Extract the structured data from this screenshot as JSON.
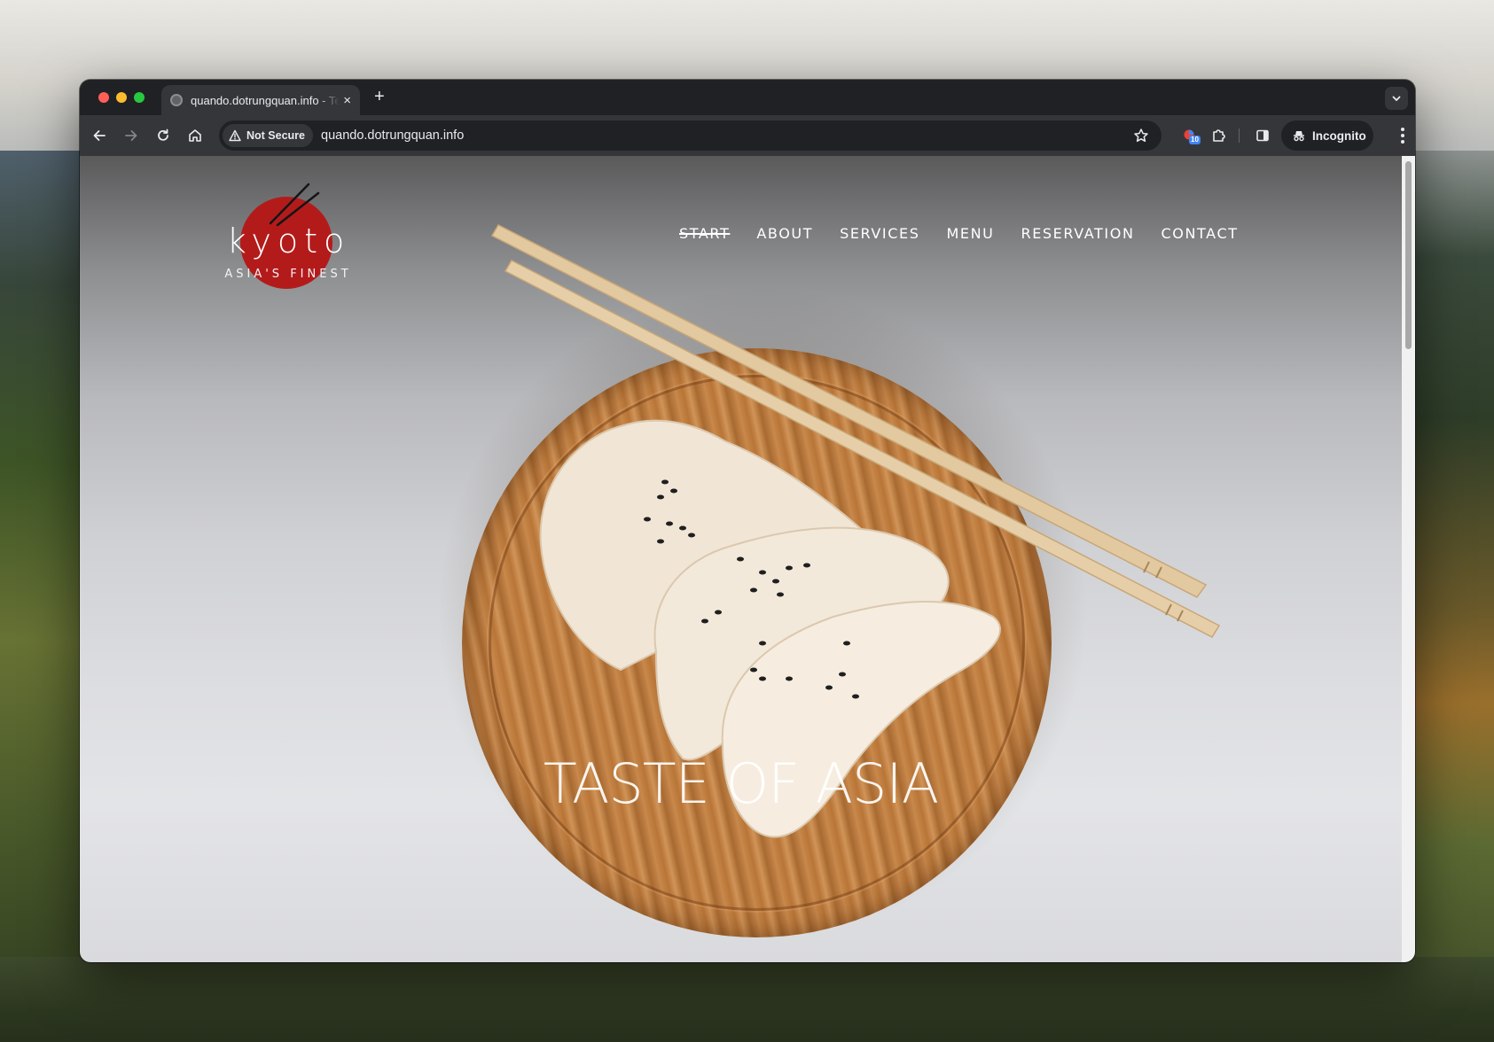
{
  "browser": {
    "tab_title": "quando.dotrungquan.info - Te",
    "tab_close": "×",
    "new_tab": "+",
    "security_label": "Not Secure",
    "url": "quando.dotrungquan.info",
    "extension_badge": "10",
    "incognito_label": "Incognito"
  },
  "site": {
    "logo_word": "kyoto",
    "logo_tagline": "ASIA'S FINEST",
    "nav": [
      "START",
      "ABOUT",
      "SERVICES",
      "MENU",
      "RESERVATION",
      "CONTACT"
    ],
    "active_nav": "START",
    "hero_title": "TASTE OF ASIA",
    "logo_color": "#b31b1b"
  },
  "icons": {
    "back": "arrow-left-icon",
    "forward": "arrow-right-icon",
    "reload": "reload-icon",
    "home": "home-icon",
    "warning": "warning-triangle-icon",
    "bookmark": "star-icon",
    "extension": "puzzle-icon",
    "side_panel": "side-panel-icon",
    "incognito": "incognito-icon",
    "menu": "kebab-menu-icon"
  }
}
